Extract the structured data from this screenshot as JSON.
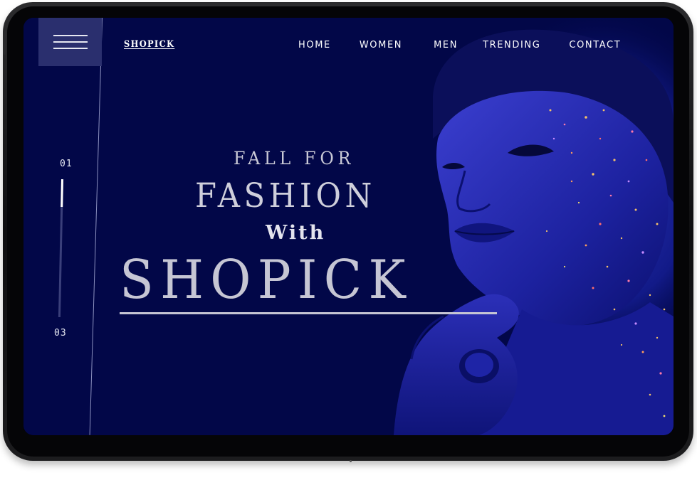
{
  "brand": "SHOPICK",
  "nav": {
    "items": [
      "HOME",
      "WOMEN",
      "MEN",
      "TRENDING",
      "CONTACT"
    ]
  },
  "slider": {
    "current": "01",
    "last": "03",
    "progress": 0.2
  },
  "hero": {
    "line1": "FALL FOR",
    "line2": "FASHION",
    "line3": "With",
    "line4": "SHOPICK"
  },
  "colors": {
    "background": "#020748",
    "accent": "#2a2f6e",
    "text": "#ffffff"
  },
  "icons": {
    "menu": "hamburger-icon"
  }
}
